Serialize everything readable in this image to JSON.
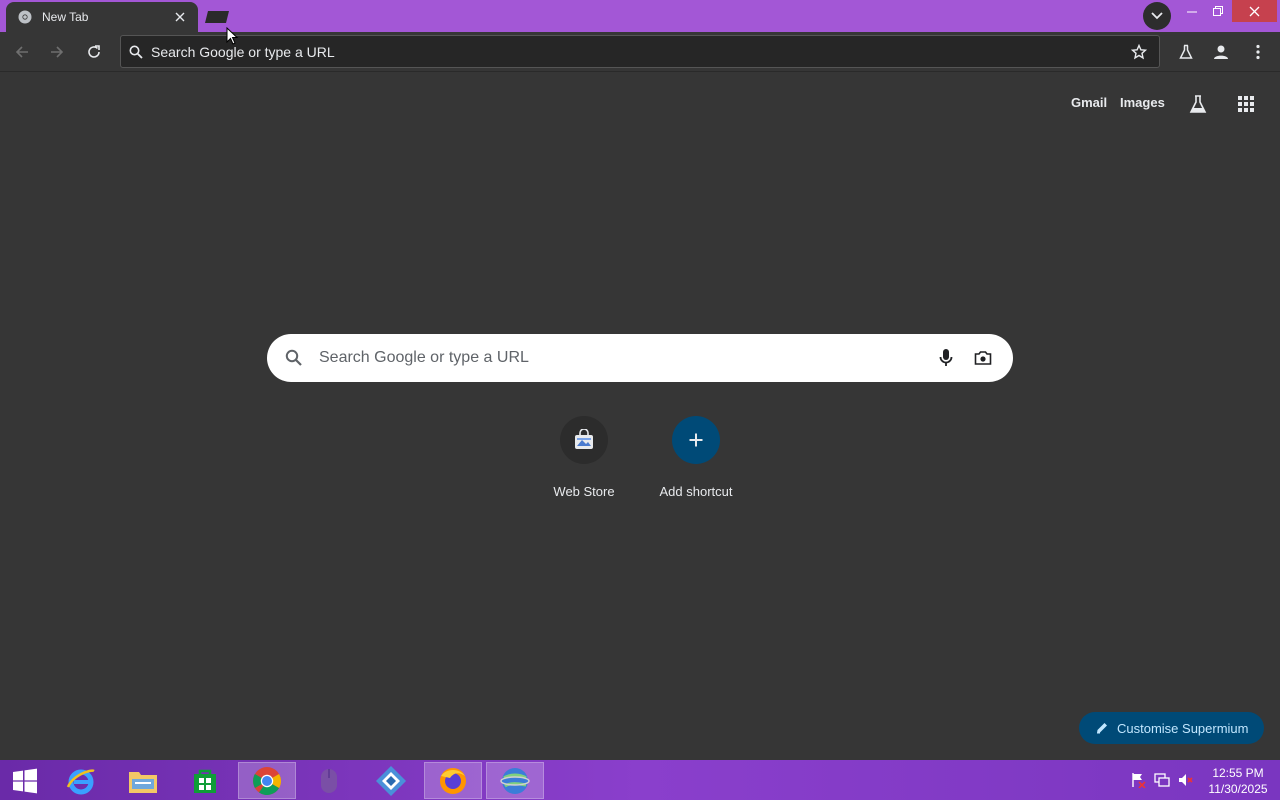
{
  "browser": {
    "tab": {
      "title": "New Tab",
      "active": true
    },
    "omnibox": {
      "placeholder": "Search Google or type a URL"
    }
  },
  "ntp": {
    "header_links": [
      "Gmail",
      "Images"
    ],
    "search": {
      "placeholder": "Search Google or type a URL"
    },
    "shortcuts": [
      {
        "label": "Web Store",
        "icon": "web-store-icon"
      },
      {
        "label": "Add shortcut",
        "icon": "plus-icon"
      }
    ],
    "customise_label": "Customise Supermium"
  },
  "taskbar": {
    "apps": [
      "internet-explorer",
      "file-explorer",
      "store",
      "chrome",
      "mouse",
      "app",
      "firefox",
      "app2"
    ],
    "active_app": "chrome",
    "clock": {
      "time": "12:55 PM",
      "date": "11/30/2025"
    }
  },
  "colors": {
    "tab_strip": "#a357d6",
    "page_bg": "#363636",
    "customise_bg": "#004a77",
    "add_shortcut_bg": "#004a77",
    "close_button": "#c6414e"
  }
}
